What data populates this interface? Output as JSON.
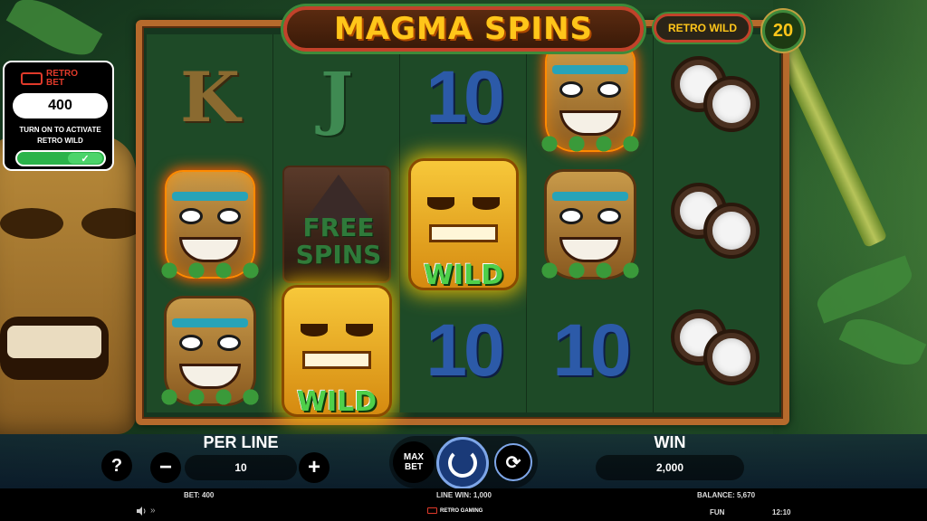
{
  "title": "MAGMA SPINS",
  "retro_wild_badge": "RETRO WILD",
  "lines_count": "20",
  "retro_bet_panel": {
    "logo_line1": "RETRO",
    "logo_line2": "BET",
    "value": "400",
    "description_line1": "TURN ON TO ACTIVATE",
    "description_line2": "RETRO WILD",
    "toggle_check": "✓"
  },
  "reels": {
    "col1": {
      "row1": "K"
    },
    "col2": {
      "row1": "J",
      "free_spins_line1": "FREE",
      "free_spins_line2": "SPINS"
    },
    "col3": {
      "row1": "10",
      "row3": "10"
    },
    "col4": {
      "row3": "10"
    },
    "wild_label": "WILD"
  },
  "controls": {
    "help": "?",
    "minus": "−",
    "plus": "+",
    "per_line_label": "PER LINE",
    "per_line_value": "10",
    "max_bet_line1": "MAX",
    "max_bet_line2": "BET",
    "autoplay": "⟳",
    "win_label": "WIN",
    "win_value": "2,000"
  },
  "info_bar": {
    "bet": "BET: 400",
    "line_win": "LINE WIN: 1,000",
    "balance": "BALANCE: 5,670",
    "brand": "RETRO GAMING",
    "mode": "FUN",
    "time": "12:10"
  },
  "colors": {
    "title_gold": "#ffc61a",
    "frame_orange": "#b66a2c",
    "wild_green": "#4fd04a",
    "toggle_green": "#2bb34a",
    "brand_red": "#e03a2a"
  }
}
